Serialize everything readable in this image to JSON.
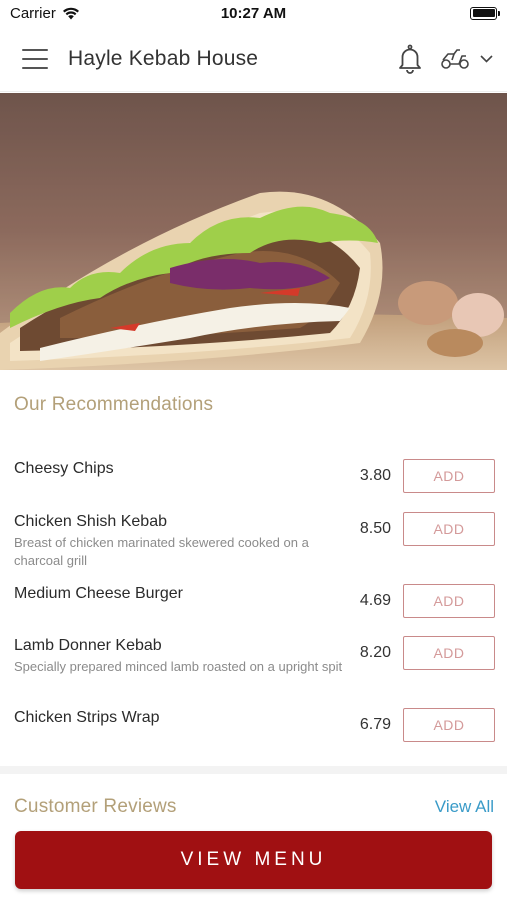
{
  "status_bar": {
    "carrier": "Carrier",
    "time": "10:27 AM"
  },
  "header": {
    "title": "Hayle Kebab House"
  },
  "recommendations": {
    "title": "Our Recommendations",
    "add_label": "ADD",
    "items": [
      {
        "name": "Cheesy Chips",
        "description": "",
        "price": "3.80"
      },
      {
        "name": "Chicken Shish Kebab",
        "description": "Breast of chicken marinated skewered cooked on a charcoal grill",
        "price": "8.50"
      },
      {
        "name": "Medium Cheese Burger",
        "description": "",
        "price": "4.69"
      },
      {
        "name": "Lamb Donner Kebab",
        "description": "Specially prepared minced lamb roasted on a upright spit",
        "price": "8.20"
      },
      {
        "name": "Chicken Strips Wrap",
        "description": "",
        "price": "6.79"
      }
    ]
  },
  "reviews": {
    "title": "Customer Reviews",
    "view_all": "View All"
  },
  "cta": {
    "label": "VIEW MENU"
  },
  "colors": {
    "accent_gold": "#b3a079",
    "brand_red": "#a01012",
    "link_blue": "#3a9bc8",
    "add_border": "#c98a8a"
  },
  "icons": {
    "menu": "hamburger-icon",
    "notifications": "bell-icon",
    "delivery": "scooter-icon",
    "dropdown": "chevron-down-icon"
  }
}
